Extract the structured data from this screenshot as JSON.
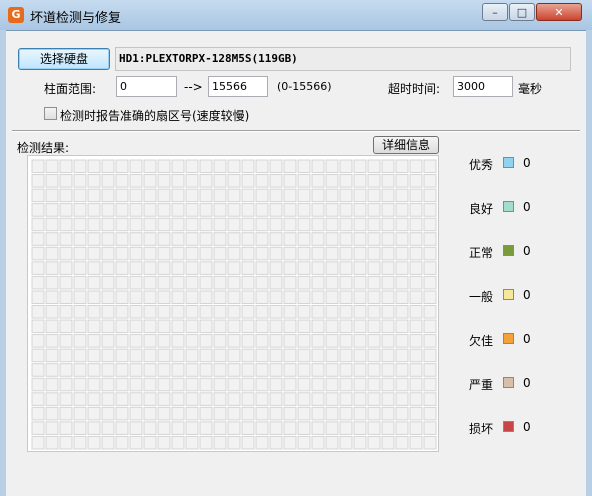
{
  "window": {
    "title": "坏道检测与修复",
    "icon_letter": "G",
    "buttons": {
      "minimize": "–",
      "maximize": "□",
      "close": "✕"
    }
  },
  "toolbar": {
    "select_disk_label": "选择硬盘",
    "disk_info": "HD1:PLEXTORPX-128M5S(119GB)"
  },
  "range": {
    "label": "柱面范围:",
    "start": "0",
    "arrow": "-->",
    "end": "15566",
    "hint": "(0-15566)"
  },
  "timeout": {
    "label": "超时时间:",
    "value": "3000",
    "unit": "毫秒"
  },
  "options": {
    "accurate_sector_label": "检测时报告准确的扇区号(速度较慢)",
    "accurate_sector_checked": false
  },
  "results": {
    "label": "检测结果:",
    "detail_button": "详细信息",
    "grid_rows": 20,
    "grid_cols": 29
  },
  "legend": [
    {
      "label": "优秀",
      "count": "0",
      "color": "#8fd3ee"
    },
    {
      "label": "良好",
      "count": "0",
      "color": "#a3dccd"
    },
    {
      "label": "正常",
      "count": "0",
      "color": "#7a9b3c"
    },
    {
      "label": "一般",
      "count": "0",
      "color": "#f6e79a"
    },
    {
      "label": "欠佳",
      "count": "0",
      "color": "#f3a23a"
    },
    {
      "label": "严重",
      "count": "0",
      "color": "#d8c0a8"
    },
    {
      "label": "损坏",
      "count": "0",
      "color": "#c94646"
    }
  ]
}
